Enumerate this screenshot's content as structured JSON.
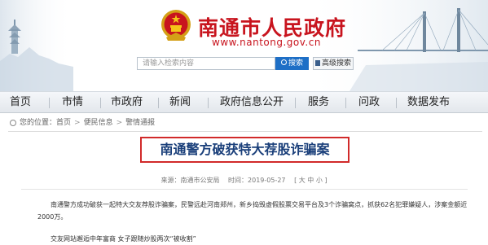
{
  "header": {
    "site_title": "南通市人民政府",
    "site_domain": "www.nantong.gov.cn"
  },
  "search": {
    "placeholder": "请输入检索内容",
    "search_label": "搜索",
    "advanced_label": "高级搜索"
  },
  "nav": {
    "items": [
      "首页",
      "市情",
      "市政府",
      "新闻",
      "政府信息公开",
      "服务",
      "问政",
      "数据发布"
    ]
  },
  "breadcrumb": {
    "label": "您的位置：",
    "items": [
      "首页",
      "便民信息",
      "警情通报"
    ]
  },
  "article": {
    "title": "南通警方破获特大荐股诈骗案",
    "source_label": "来源：南通市公安局",
    "date_label": "时间：2019-05-27",
    "font_size_label": "[ 大 中 小 ]",
    "paragraph1": "南通警方成功破获一起特大交友荐股诈骗案，民警远赴河南郑州，新乡捣毁虚假股票交易平台及3个诈骗窝点，抓获62名犯罪嫌疑人，涉案金额近2000万。",
    "paragraph2": "交友网站邂逅中年富商 女子跟随炒股两次“被收割”"
  },
  "colors": {
    "brand_red": "#c8141e",
    "title_blue": "#1a3f7a",
    "search_blue": "#1e6fc6",
    "highlight_border": "#d12a2a"
  }
}
